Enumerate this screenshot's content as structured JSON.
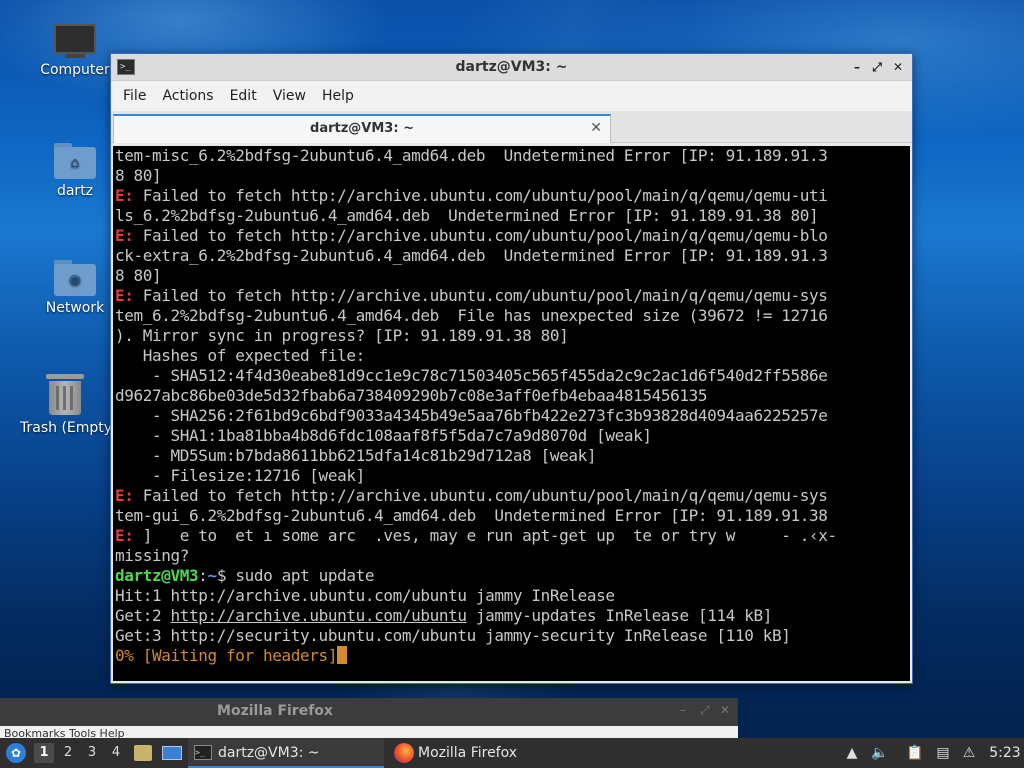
{
  "desktop": {
    "icons": [
      {
        "label": "Computer"
      },
      {
        "label": "dartz"
      },
      {
        "label": "Network"
      },
      {
        "label": "Trash (Empty)"
      }
    ]
  },
  "terminal_window": {
    "title": "dartz@VM3: ~",
    "menu": [
      "File",
      "Actions",
      "Edit",
      "View",
      "Help"
    ],
    "tab_label": "dartz@VM3: ~",
    "controls": {
      "minimize": "–",
      "maximize": "⤢",
      "close": "✕"
    },
    "lines": [
      {
        "text": "tem-misc_6.2%2bdfsg-2ubuntu6.4_amd64.deb  Undetermined Error [IP: 91.189.91.3"
      },
      {
        "text": "8 80]"
      },
      {
        "prefix": "E:",
        "text": " Failed to fetch http://archive.ubuntu.com/ubuntu/pool/main/q/qemu/qemu-uti"
      },
      {
        "text": "ls_6.2%2bdfsg-2ubuntu6.4_amd64.deb  Undetermined Error [IP: 91.189.91.38 80]"
      },
      {
        "prefix": "E:",
        "text": " Failed to fetch http://archive.ubuntu.com/ubuntu/pool/main/q/qemu/qemu-blo"
      },
      {
        "text": "ck-extra_6.2%2bdfsg-2ubuntu6.4_amd64.deb  Undetermined Error [IP: 91.189.91.3"
      },
      {
        "text": "8 80]"
      },
      {
        "prefix": "E:",
        "text": " Failed to fetch http://archive.ubuntu.com/ubuntu/pool/main/q/qemu/qemu-sys"
      },
      {
        "text": "tem_6.2%2bdfsg-2ubuntu6.4_amd64.deb  File has unexpected size (39672 != 12716"
      },
      {
        "text": "). Mirror sync in progress? [IP: 91.189.91.38 80]"
      },
      {
        "text": "   Hashes of expected file:"
      },
      {
        "text": "    - SHA512:4f4d30eabe81d9cc1e9c78c71503405c565f455da2c9c2ac1d6f540d2ff5586e"
      },
      {
        "text": "d9627abc86be03de5d32fbab6a738409290b7c08e3aff0efb4ebaa4815456135"
      },
      {
        "text": "    - SHA256:2f61bd9c6bdf9033a4345b49e5aa76bfb422e273fc3b93828d4094aa6225257e"
      },
      {
        "text": "    - SHA1:1ba81bba4b8d6fdc108aaf8f5f5da7c7a9d8070d [weak]"
      },
      {
        "text": "    - MD5Sum:b7bda8611bb6215dfa14c81b29d712a8 [weak]"
      },
      {
        "text": "    - Filesize:12716 [weak]"
      },
      {
        "prefix": "E:",
        "text": " Failed to fetch http://archive.ubuntu.com/ubuntu/pool/main/q/qemu/qemu-sys"
      },
      {
        "text": "tem-gui_6.2%2bdfsg-2ubuntu6.4_amd64.deb  Undetermined Error [IP: 91.189.91.38"
      },
      {
        "prefix": "E:",
        "text": " ]   e to  et ı some arc  .ves, may e run apt-get up  te or try w     - .‹x-"
      },
      {
        "text": "missing?"
      }
    ],
    "prompt": {
      "user": "dartz@VM3",
      "sep": ":",
      "path": "~",
      "symbol": "$",
      "command": " sudo apt update"
    },
    "output": [
      {
        "text": "Hit:1 http://archive.ubuntu.com/ubuntu jammy InRelease"
      },
      {
        "lead": "Get:2 ",
        "link": "http://archive.ubuntu.com/ubuntu",
        "rest": " jammy-updates InRelease [114 kB]"
      },
      {
        "text": "Get:3 http://security.ubuntu.com/ubuntu jammy-security InRelease [110 kB]"
      }
    ],
    "progress": "0% [Waiting for headers]"
  },
  "firefox_window": {
    "title": "Mozilla Firefox",
    "subtext": "Bookmarks  Tools  Help"
  },
  "taskbar": {
    "workspaces": [
      "1",
      "2",
      "3",
      "4"
    ],
    "active_workspace": "1",
    "tasks": [
      {
        "label": "dartz@VM3: ~"
      },
      {
        "label": "Mozilla Firefox"
      }
    ],
    "clock": "5:23"
  }
}
